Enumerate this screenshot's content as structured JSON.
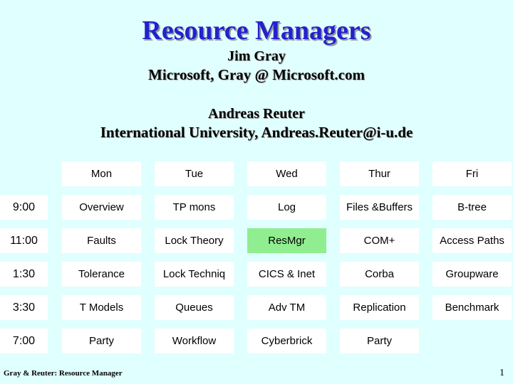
{
  "slide": {
    "background_color": "#E0FFFF",
    "title": "Resource Managers",
    "title_color": "#2222CC",
    "author_1": "Jim Gray",
    "affiliation_1": "Microsoft,  Gray @ Microsoft.com",
    "author_2": "Andreas Reuter",
    "affiliation_2": "International University, Andreas.Reuter@i-u.de"
  },
  "schedule": {
    "corner_label": "",
    "day_headers": [
      "Mon",
      "Tue",
      "Wed",
      "Thur",
      "Fri"
    ],
    "highlight_color": "#90EE90",
    "cell_color": "#FFFFFF",
    "rows": [
      {
        "time": "9:00",
        "cells": [
          {
            "label": "Overview",
            "highlight": false
          },
          {
            "label": "TP mons",
            "highlight": false
          },
          {
            "label": "Log",
            "highlight": false
          },
          {
            "label": "Files &Buffers",
            "highlight": false
          },
          {
            "label": "B-tree",
            "highlight": false
          }
        ]
      },
      {
        "time": "11:00",
        "cells": [
          {
            "label": "Faults",
            "highlight": false
          },
          {
            "label": "Lock Theory",
            "highlight": false
          },
          {
            "label": "ResMgr",
            "highlight": true
          },
          {
            "label": "COM+",
            "highlight": false
          },
          {
            "label": "Access Paths",
            "highlight": false
          }
        ]
      },
      {
        "time": "1:30",
        "cells": [
          {
            "label": "Tolerance",
            "highlight": false
          },
          {
            "label": "Lock Techniq",
            "highlight": false
          },
          {
            "label": "CICS & Inet",
            "highlight": false
          },
          {
            "label": "Corba",
            "highlight": false
          },
          {
            "label": "Groupware",
            "highlight": false
          }
        ]
      },
      {
        "time": "3:30",
        "cells": [
          {
            "label": "T Models",
            "highlight": false
          },
          {
            "label": "Queues",
            "highlight": false
          },
          {
            "label": "Adv TM",
            "highlight": false
          },
          {
            "label": "Replication",
            "highlight": false
          },
          {
            "label": "Benchmark",
            "highlight": false
          }
        ]
      },
      {
        "time": "7:00",
        "cells": [
          {
            "label": "Party",
            "highlight": false
          },
          {
            "label": "Workflow",
            "highlight": false
          },
          {
            "label": "Cyberbrick",
            "highlight": false
          },
          {
            "label": "Party",
            "highlight": false
          },
          {
            "label": "",
            "highlight": false,
            "empty": true
          }
        ]
      }
    ]
  },
  "footer": {
    "text": "Gray & Reuter: Resource Manager",
    "page_number": "1"
  }
}
